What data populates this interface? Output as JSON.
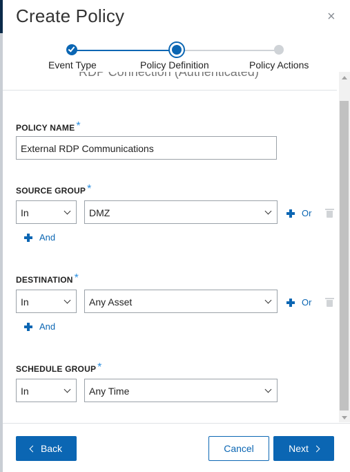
{
  "dialog": {
    "title": "Create Policy",
    "close_glyph": "×"
  },
  "stepper": {
    "steps": [
      {
        "label": "Event Type",
        "state": "complete"
      },
      {
        "label": "Policy Definition",
        "state": "active"
      },
      {
        "label": "Policy Actions",
        "state": "pending"
      }
    ]
  },
  "content": {
    "peek_text": "RDP Connection (Authenticated)",
    "policy_name": {
      "label": "POLICY NAME",
      "required_mark": "*",
      "value": "External RDP Communications"
    },
    "source_group": {
      "label": "SOURCE GROUP",
      "required_mark": "*",
      "operator": "In",
      "value": "DMZ",
      "or_label": "Or",
      "and_label": "And"
    },
    "destination": {
      "label": "DESTINATION",
      "required_mark": "*",
      "operator": "In",
      "value": "Any Asset",
      "or_label": "Or",
      "and_label": "And"
    },
    "schedule_group": {
      "label": "SCHEDULE GROUP",
      "required_mark": "*",
      "operator": "In",
      "value": "Any Time"
    }
  },
  "footer": {
    "back_label": "Back",
    "cancel_label": "Cancel",
    "next_label": "Next"
  },
  "colors": {
    "accent": "#0b66b3",
    "required": "#2b8fe0",
    "pending_step": "#cfd3d7",
    "sidebar_edge": "#0b2a4a"
  }
}
